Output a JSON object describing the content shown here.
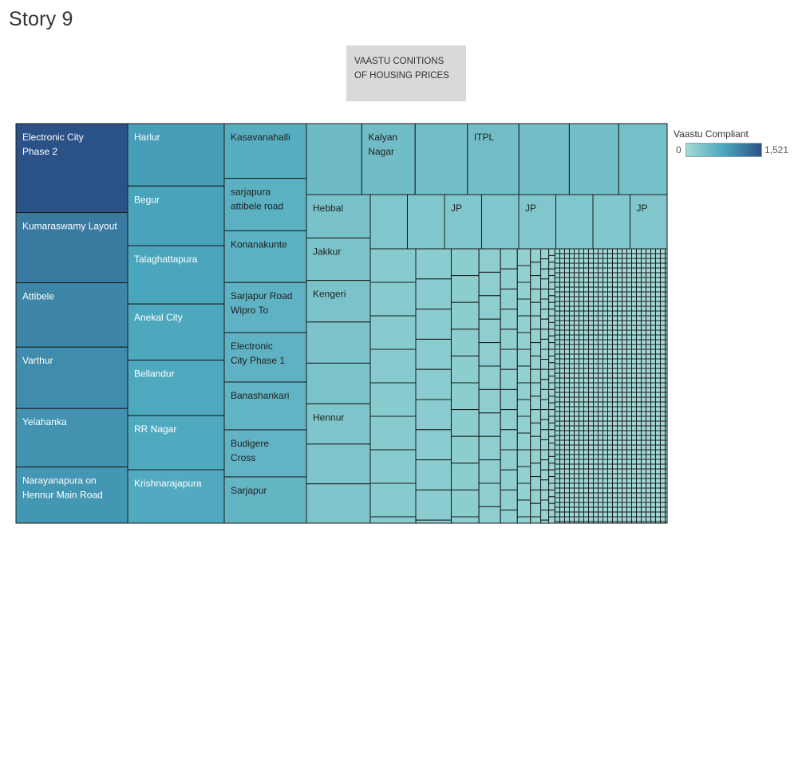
{
  "story": {
    "title": "Story 9"
  },
  "caption": {
    "text": "VAASTU CONITIONS OF HOUSING PRICES"
  },
  "legend": {
    "title": "Vaastu Compliant",
    "min": "0",
    "max": "1,521"
  },
  "colors": {
    "low": "#a4dbd6",
    "mid": "#4aa6bd",
    "high": "#2b5286",
    "border": "#1a1a1a",
    "label_dark": "#222222",
    "label_light": "#ffffff"
  },
  "chart_data": {
    "type": "treemap",
    "measure": "Vaastu Compliant",
    "color_range": [
      0,
      1521
    ],
    "nodes": [
      {
        "label": "Electronic City Phase 2",
        "value": 1521
      },
      {
        "label": "Kumaraswamy Layout",
        "value": 1200
      },
      {
        "label": "Attibele",
        "value": 1100
      },
      {
        "label": "Varthur",
        "value": 1050
      },
      {
        "label": "Yelahanka",
        "value": 1000
      },
      {
        "label": "Narayanapura on Hennur Main Road",
        "value": 960
      },
      {
        "label": "Harlur",
        "value": 900
      },
      {
        "label": "Begur",
        "value": 860
      },
      {
        "label": "Talaghattapura",
        "value": 840
      },
      {
        "label": "Anekal City",
        "value": 810
      },
      {
        "label": "Bellandur",
        "value": 800
      },
      {
        "label": "RR Nagar",
        "value": 780
      },
      {
        "label": "Krishnarajapura",
        "value": 770
      },
      {
        "label": "Kasavanahalli",
        "value": 710
      },
      {
        "label": "sarjapura attibele road",
        "value": 680
      },
      {
        "label": "Konanakunte",
        "value": 670
      },
      {
        "label": "Sarjapur Road Wipro To",
        "value": 650
      },
      {
        "label": "Electronic City Phase 1",
        "value": 640
      },
      {
        "label": "Banashankari",
        "value": 620
      },
      {
        "label": "Budigere Cross",
        "value": 610
      },
      {
        "label": "Sarjapur",
        "value": 600
      },
      {
        "label": "",
        "value": 560
      },
      {
        "label": "Kalyan Nagar",
        "value": 540
      },
      {
        "label": "",
        "value": 530
      },
      {
        "label": "ITPL",
        "value": 520
      },
      {
        "label": "",
        "value": 510
      },
      {
        "label": "",
        "value": 500
      },
      {
        "label": "",
        "value": 490
      },
      {
        "label": "Hebbal",
        "value": 480
      },
      {
        "label": "Jakkur",
        "value": 470
      },
      {
        "label": "Kengeri",
        "value": 460
      },
      {
        "label": "",
        "value": 455
      },
      {
        "label": "",
        "value": 450
      },
      {
        "label": "Hennur",
        "value": 445
      },
      {
        "label": "",
        "value": 440
      },
      {
        "label": "",
        "value": 435
      },
      {
        "label": "JP",
        "value": 430
      },
      {
        "label": "JP",
        "value": 425
      },
      {
        "label": "JP",
        "value": 420
      }
    ]
  }
}
